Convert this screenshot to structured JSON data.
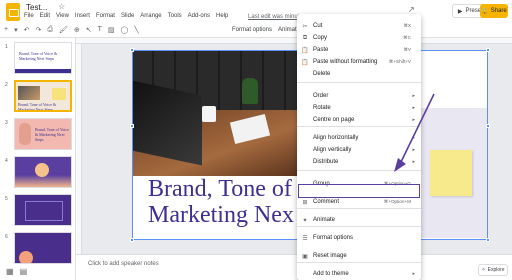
{
  "header": {
    "doc_title": "Test...",
    "menu": [
      "File",
      "Edit",
      "View",
      "Insert",
      "Format",
      "Slide",
      "Arrange",
      "Tools",
      "Add-ons",
      "Help"
    ],
    "last_edit": "Last edit was minutes ago",
    "present_label": "Present",
    "share_label": "Share"
  },
  "toolbar": {
    "format_options": "Format options",
    "animate": "Animat"
  },
  "filmstrip": {
    "slides": [
      {
        "num": "1",
        "text": "Brand, Tone of Voice & Marketing Next Steps"
      },
      {
        "num": "2",
        "text": "Brand, Tone of Voice & Marketing Next Steps"
      },
      {
        "num": "3",
        "text": "Brand, Tone of Voice & Marketing Next Steps"
      },
      {
        "num": "4",
        "text": ""
      },
      {
        "num": "5",
        "text": ""
      },
      {
        "num": "6",
        "text": ""
      }
    ]
  },
  "slide": {
    "title_line1": "Brand, Tone of",
    "title_line2": "Marketing Nex"
  },
  "notes": {
    "placeholder": "Click to add speaker notes"
  },
  "explore": {
    "label": "Explore"
  },
  "context_menu": {
    "items": [
      {
        "icon": "cut-icon",
        "glyph": "✂",
        "label": "Cut",
        "shortcut": "⌘X",
        "submenu": false
      },
      {
        "icon": "copy-icon",
        "glyph": "⧉",
        "label": "Copy",
        "shortcut": "⌘C",
        "submenu": false
      },
      {
        "icon": "paste-icon",
        "glyph": "📋",
        "label": "Paste",
        "shortcut": "⌘V",
        "submenu": false
      },
      {
        "icon": "paste-plain-icon",
        "glyph": "📋",
        "label": "Paste without formatting",
        "shortcut": "⌘+Shift+V",
        "submenu": false
      },
      {
        "icon": "",
        "glyph": "",
        "label": "Delete",
        "shortcut": "",
        "submenu": false
      },
      {
        "icon": "",
        "glyph": "",
        "label": "Order",
        "shortcut": "",
        "submenu": true
      },
      {
        "icon": "",
        "glyph": "",
        "label": "Rotate",
        "shortcut": "",
        "submenu": true
      },
      {
        "icon": "",
        "glyph": "",
        "label": "Centre on page",
        "shortcut": "",
        "submenu": true
      },
      {
        "icon": "",
        "glyph": "",
        "label": "Align horizontally",
        "shortcut": "",
        "submenu": true
      },
      {
        "icon": "",
        "glyph": "",
        "label": "Align vertically",
        "shortcut": "",
        "submenu": true
      },
      {
        "icon": "",
        "glyph": "",
        "label": "Distribute",
        "shortcut": "",
        "submenu": true
      },
      {
        "icon": "",
        "glyph": "",
        "label": "Group",
        "shortcut": "⌘+Option+G",
        "submenu": false
      },
      {
        "icon": "comment-icon",
        "glyph": "⊞",
        "label": "Comment",
        "shortcut": "⌘+Option+M",
        "submenu": false
      },
      {
        "icon": "animate-icon",
        "glyph": "✦",
        "label": "Animate",
        "shortcut": "",
        "submenu": false
      },
      {
        "icon": "format-options-icon",
        "glyph": "☰",
        "label": "Format options",
        "shortcut": "",
        "submenu": false
      },
      {
        "icon": "reset-image-icon",
        "glyph": "▣",
        "label": "Reset image",
        "shortcut": "",
        "submenu": false
      },
      {
        "icon": "",
        "glyph": "",
        "label": "Add to theme",
        "shortcut": "",
        "submenu": true
      }
    ]
  },
  "colors": {
    "accent": "#f4b400",
    "title_purple": "#3c2f8f",
    "selection_blue": "#5b8ff9",
    "highlight_border": "#5a3fa0"
  }
}
